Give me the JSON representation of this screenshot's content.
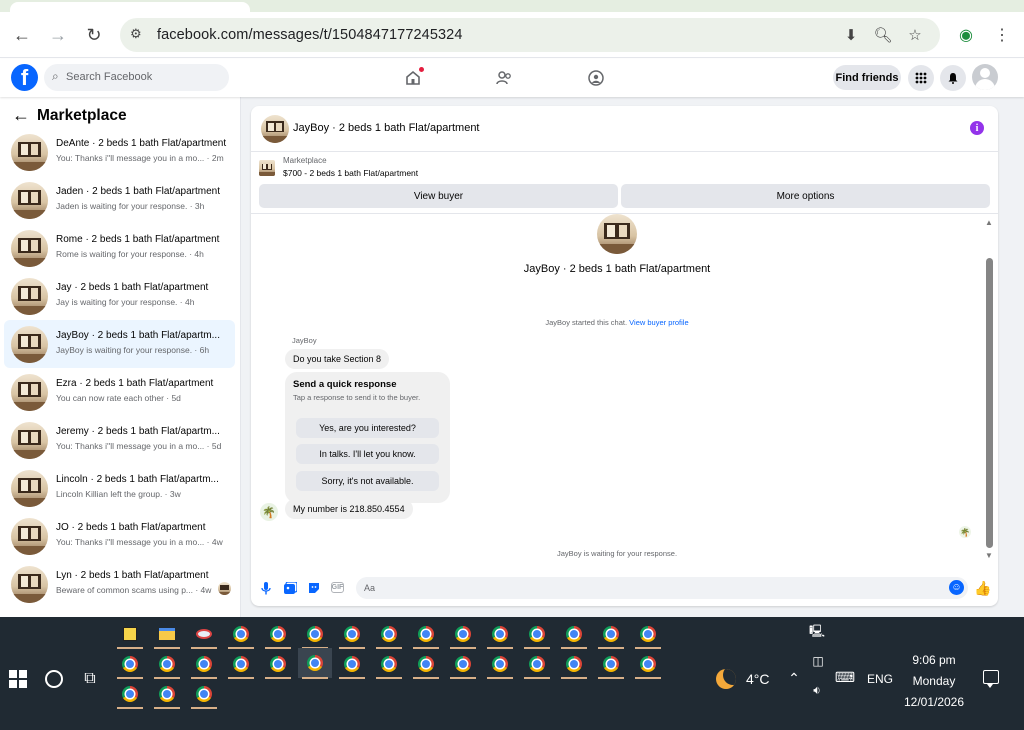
{
  "browser": {
    "url": "facebook.com/messages/t/1504847177245324"
  },
  "fb": {
    "search_placeholder": "Search Facebook",
    "find_friends": "Find friends"
  },
  "sidebar": {
    "title": "Marketplace",
    "conversations": [
      {
        "title": "DeAnte · 2 beds 1 bath Flat/apartment",
        "subtitle": "You: Thanks i''ll message you in a mo... · 2m",
        "active": false
      },
      {
        "title": "Jaden · 2 beds 1 bath Flat/apartment",
        "subtitle": "Jaden is waiting for your response. · 3h",
        "active": false
      },
      {
        "title": "Rome · 2 beds 1 bath Flat/apartment",
        "subtitle": "Rome is waiting for your response. · 4h",
        "active": false
      },
      {
        "title": "Jay · 2 beds 1 bath Flat/apartment",
        "subtitle": "Jay is waiting for your response. · 4h",
        "active": false
      },
      {
        "title": "JayBoy · 2 beds 1 bath Flat/apartm...",
        "subtitle": "JayBoy is waiting for your response. · 6h",
        "active": true
      },
      {
        "title": "Ezra · 2 beds 1 bath Flat/apartment",
        "subtitle": "You can now rate each other · 5d",
        "active": false
      },
      {
        "title": "Jeremy · 2 beds 1 bath Flat/apartm...",
        "subtitle": "You: Thanks i''ll message you in a mo... · 5d",
        "active": false
      },
      {
        "title": "Lincoln · 2 beds 1 bath Flat/apartm...",
        "subtitle": "Lincoln Killian left the group. · 3w",
        "active": false
      },
      {
        "title": "JO · 2 beds 1 bath Flat/apartment",
        "subtitle": "You: Thanks i''ll message you in a mo... · 4w",
        "active": false
      },
      {
        "title": "Lyn · 2 beds 1 bath Flat/apartment",
        "subtitle": "Beware of common scams using p... · 4w",
        "active": false
      }
    ]
  },
  "chat": {
    "header_title": "JayBoy · 2 beds 1 bath Flat/apartment",
    "listing_category": "Marketplace",
    "listing_price": "$700 - 2 beds 1 bath Flat/apartment",
    "view_buyer": "View buyer",
    "more_options": "More options",
    "convo_title": "JayBoy · 2 beds 1 bath Flat/apartment",
    "started_text": "JayBoy started this chat.",
    "view_buyer_profile": "View buyer profile",
    "sender_name": "JayBoy",
    "msg_1": "Do you take Section 8",
    "quick_title": "Send a quick response",
    "quick_sub": "Tap a response to send it to the buyer.",
    "quick_options": [
      "Yes, are you interested?",
      "In talks. I'll let you know.",
      "Sorry, it's not available."
    ],
    "msg_2": "My number is 218.850.4554",
    "waiting": "JayBoy is waiting for your response.",
    "input_placeholder": "Aa"
  },
  "taskbar": {
    "temperature": "4°C",
    "language": "ENG",
    "time": "9:06 pm",
    "day": "Monday",
    "date": "12/01/2026"
  },
  "colors": {
    "fb_blue": "#0866ff",
    "active_row": "#ebf5ff",
    "taskbar": "#202a33",
    "info_purple": "#9333ea"
  }
}
